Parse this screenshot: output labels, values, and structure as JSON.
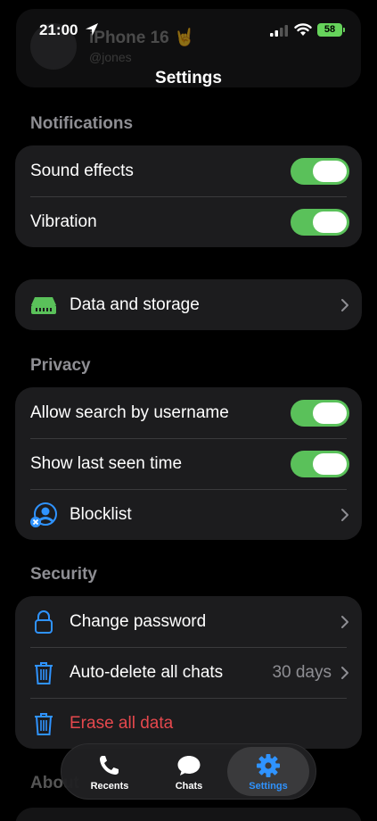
{
  "status_bar": {
    "time": "21:00",
    "battery": "58"
  },
  "background_profile": {
    "name": "iPhone 16 🤘",
    "username": "@jones"
  },
  "header": {
    "title": "Settings"
  },
  "notifications": {
    "title": "Notifications",
    "rows": [
      {
        "label": "Sound effects",
        "on": true
      },
      {
        "label": "Vibration",
        "on": true
      }
    ]
  },
  "storage": {
    "label": "Data and storage"
  },
  "privacy": {
    "title": "Privacy",
    "rows": [
      {
        "label": "Allow search by username",
        "on": true
      },
      {
        "label": "Show last seen time",
        "on": true
      },
      {
        "label": "Blocklist"
      }
    ]
  },
  "security": {
    "title": "Security",
    "rows": [
      {
        "label": "Change password"
      },
      {
        "label": "Auto-delete all chats",
        "value": "30 days"
      },
      {
        "label": "Erase all data"
      }
    ]
  },
  "about": {
    "title": "About"
  },
  "tabs": [
    {
      "label": "Recents",
      "icon": "phone-icon",
      "active": false
    },
    {
      "label": "Chats",
      "icon": "chat-bubble-icon",
      "active": false
    },
    {
      "label": "Settings",
      "icon": "gear-icon",
      "active": true
    }
  ],
  "colors": {
    "accent": "#2f93ff",
    "toggle_on": "#5ac15a",
    "danger": "#e5484d",
    "card": "#1c1c1e"
  }
}
